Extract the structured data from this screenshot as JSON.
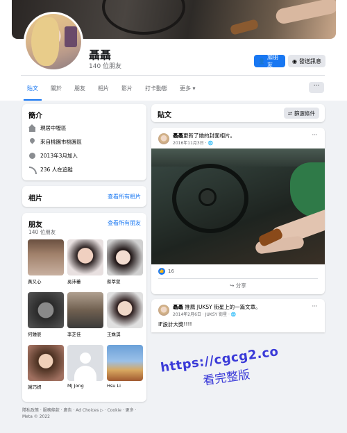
{
  "profile": {
    "name": "聶聶",
    "friends_count": "140 位朋友",
    "add_friend_label": "加朋友",
    "message_label": "發送訊息"
  },
  "tabs": [
    "貼文",
    "關於",
    "朋友",
    "相片",
    "影片",
    "打卡動態",
    "更多"
  ],
  "intro": {
    "title": "簡介",
    "items": [
      {
        "icon": "home-icon",
        "text": "現居中壢區"
      },
      {
        "icon": "location-pin-icon",
        "text": "來自桃園市桃園區"
      },
      {
        "icon": "clock-icon",
        "text": "2013年3月加入"
      },
      {
        "icon": "rss-icon",
        "text": "236 人在追蹤"
      }
    ]
  },
  "photos": {
    "title": "相片",
    "see_all": "查看所有相片"
  },
  "friends": {
    "title": "朋友",
    "see_all": "查看所有朋友",
    "count": "140 位朋友",
    "list": [
      {
        "name": "黃又心"
      },
      {
        "name": "吳沛蓁"
      },
      {
        "name": "蔡萃萱"
      },
      {
        "name": "何鍾辰"
      },
      {
        "name": "李芝佳"
      },
      {
        "name": "王姝淇"
      },
      {
        "name": "謝巧妍"
      },
      {
        "name": "MJ Jong"
      },
      {
        "name": "Hsu Li"
      }
    ]
  },
  "footer": {
    "line1": "隱私政策 · 服務條款 · 廣告 · Ad Choices ▷ · Cookie · 更多 ·",
    "line2": "Meta © 2022"
  },
  "posts_header": {
    "title": "貼文",
    "filter_label": "篩選條件"
  },
  "posts": [
    {
      "author": "聶聶",
      "action": "更新了她的封面相片。",
      "date": "2016年11月3日 · ",
      "reactions": "16",
      "share_label": "分享"
    },
    {
      "author": "聶聶",
      "action": "推薦 JUKSY 街星上的一篇文章。",
      "date": "2014年2月6日 · JUKSY 街星 · ",
      "body": "IF設計大獎!!!!"
    }
  ],
  "watermark": {
    "line1": "https://cgcg2.co",
    "line2": "看完整版"
  },
  "colors": {
    "accent": "#1877f2",
    "background": "#f0f2f5",
    "watermark": "#3a3ad8"
  }
}
